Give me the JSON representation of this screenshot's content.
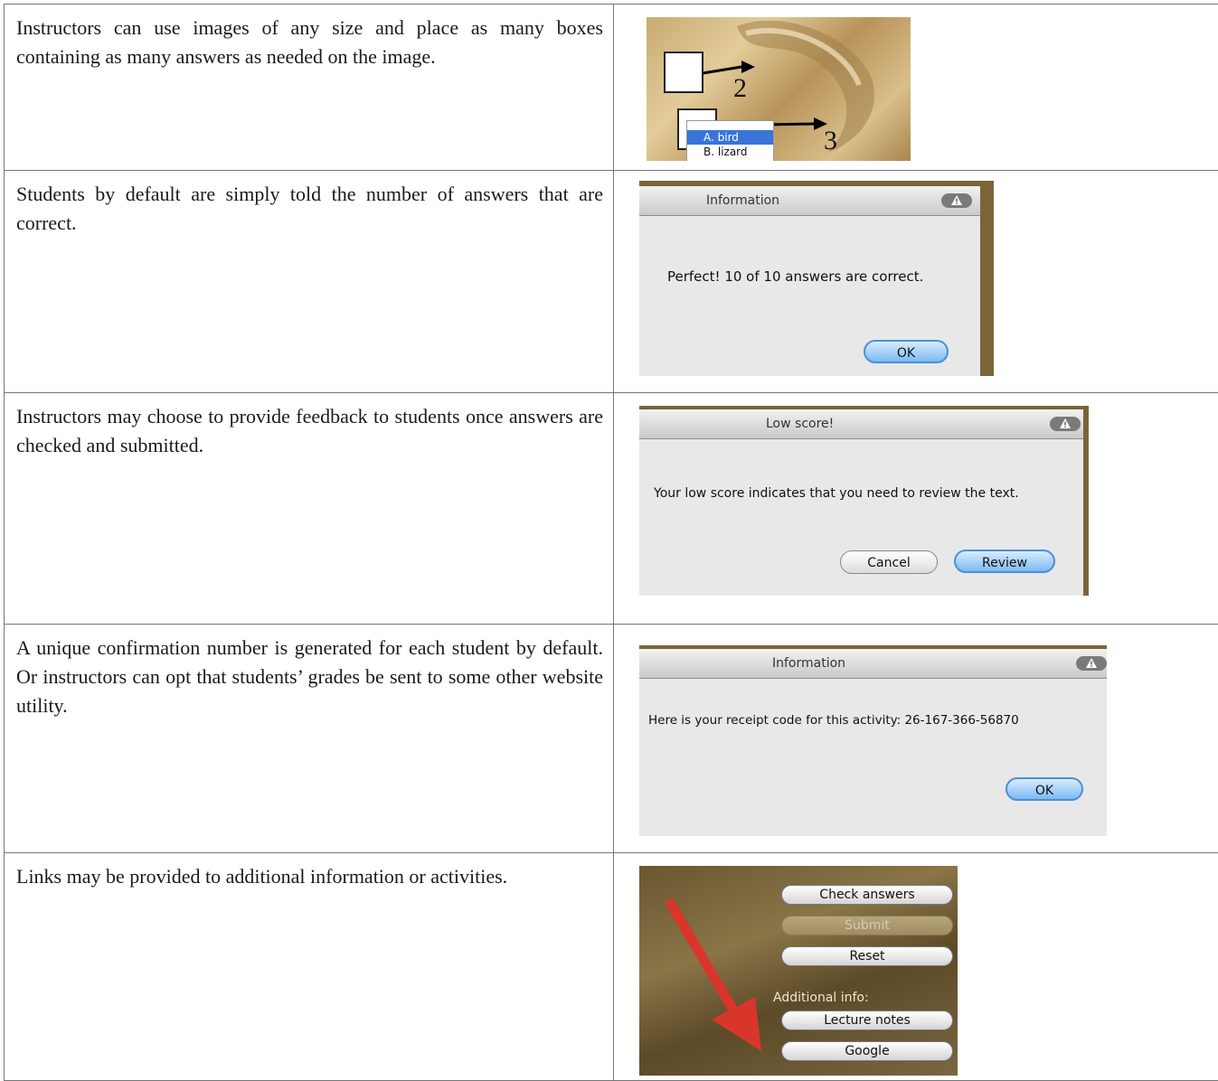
{
  "rows": [
    {
      "text": "Instructors can use images of any size and place as many boxes containing as many answers as needed on the image.",
      "image": {
        "labels": [
          "2",
          "3"
        ],
        "dropdown": [
          "A. bird",
          "B. lizard"
        ]
      }
    },
    {
      "text": "Students by default are simply told the number of answers that are correct.",
      "dialog": {
        "title": "Information",
        "message": "Perfect!  10 of 10 answers are correct.",
        "buttons": [
          "OK"
        ]
      }
    },
    {
      "text": "Instructors  may choose to provide feedback to students once answers are checked and submitted.",
      "dialog": {
        "title": "Low score!",
        "message": "Your low score indicates that you need to review the text.",
        "buttons": [
          "Cancel",
          "Review"
        ]
      }
    },
    {
      "text": "A unique confirmation number is generated for each student by default.  Or instructors can opt that students’ grades be sent to some other website utility.",
      "dialog": {
        "title": "Information",
        "message": "Here is your receipt code for this activity: 26-167-366-56870",
        "buttons": [
          "OK"
        ]
      }
    },
    {
      "text": "Links may be provided to additional information or activities.",
      "panel": {
        "buttons": [
          "Check answers",
          "Submit",
          "Reset"
        ],
        "section_label": "Additional info:",
        "links": [
          "Lecture notes",
          "Google"
        ]
      }
    }
  ],
  "colors": {
    "dialog_bg": "#e8e8e8",
    "default_button": "#7db9f2",
    "arrow_red": "#d9362b",
    "border": "#777777"
  }
}
